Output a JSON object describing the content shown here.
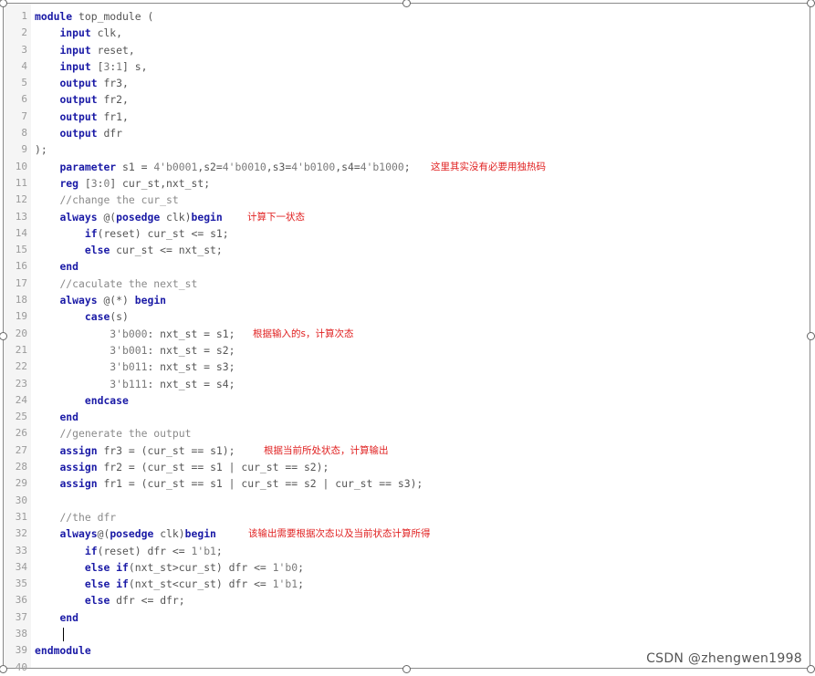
{
  "editor": {
    "lines": [
      "module top_module (",
      "    input clk,",
      "    input reset,",
      "    input [3:1] s,",
      "    output fr3,",
      "    output fr2,",
      "    output fr1,",
      "    output dfr",
      ");",
      "    parameter s1 = 4'b0001,s2=4'b0010,s3=4'b0100,s4=4'b1000;",
      "    reg [3:0] cur_st,nxt_st;",
      "    //change the cur_st",
      "    always @(posedge clk)begin",
      "        if(reset) cur_st <= s1;",
      "        else cur_st <= nxt_st;",
      "    end",
      "    //caculate the next_st",
      "    always @(*) begin",
      "        case(s)",
      "            3'b000: nxt_st = s1;",
      "            3'b001: nxt_st = s2;",
      "            3'b011: nxt_st = s3;",
      "            3'b111: nxt_st = s4;",
      "        endcase",
      "    end",
      "    //generate the output",
      "    assign fr3 = (cur_st == s1);",
      "    assign fr2 = (cur_st == s1 | cur_st == s2);",
      "    assign fr1 = (cur_st == s1 | cur_st == s2 | cur_st == s3);",
      "",
      "    //the dfr",
      "    always@(posedge clk)begin",
      "        if(reset) dfr <= 1'b1;",
      "        else if(nxt_st>cur_st) dfr <= 1'b0;",
      "        else if(nxt_st<cur_st) dfr <= 1'b1;",
      "        else dfr <= dfr;",
      "    end",
      "",
      "endmodule",
      ""
    ],
    "annotations": [
      {
        "line": 10,
        "text": "这里其实没有必要用独热码"
      },
      {
        "line": 13,
        "text": "计算下一状态"
      },
      {
        "line": 20,
        "text": "根据输入的s，计算次态"
      },
      {
        "line": 27,
        "text": "根据当前所处状态，计算输出"
      },
      {
        "line": 32,
        "text": "该输出需要根据次态以及当前状态计算所得"
      }
    ],
    "cursor_line": 38
  },
  "watermark": "CSDN @zhengwen1998",
  "colors": {
    "keyword": "#1a1aa6",
    "annotation": "#e02020",
    "line_number": "#9a9a9a"
  }
}
